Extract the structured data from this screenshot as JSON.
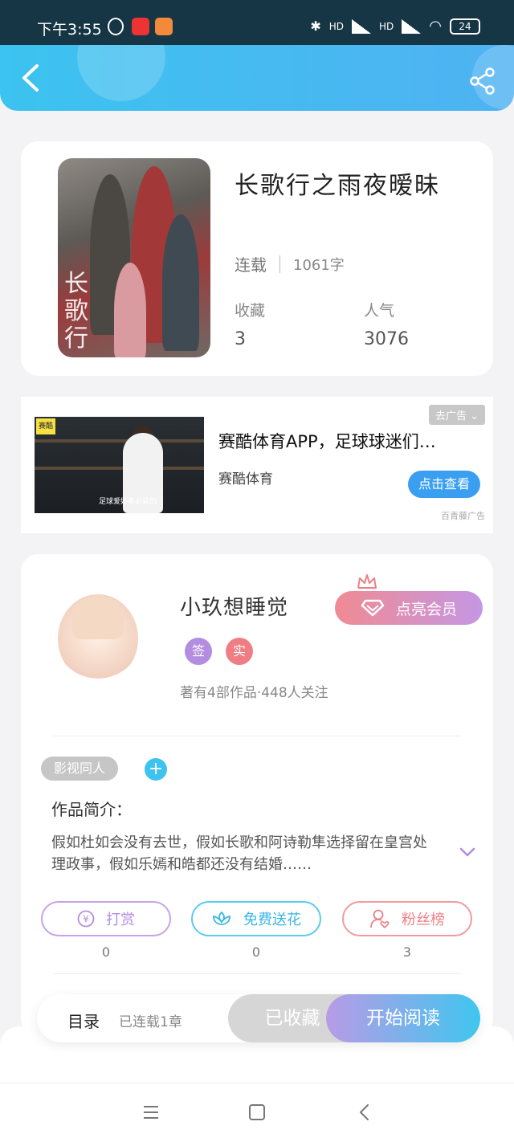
{
  "status_bar": {
    "time": "下午3:55",
    "battery": "24",
    "icons": [
      "alarm-icon",
      "netease-music-icon",
      "app-icon",
      "bluetooth-icon",
      "signal-icon",
      "signal-icon",
      "wifi-icon",
      "battery-icon"
    ],
    "hd_label": "HD"
  },
  "header": {
    "back_icon": "chevron-left-icon",
    "share_icon": "share-icon",
    "accent": "#3cc3f0"
  },
  "book": {
    "title": "长歌行之雨夜暧昧",
    "cover_text": "长歌行",
    "status": "连载",
    "word_count": "1061字",
    "favorites_label": "收藏",
    "favorites_value": "3",
    "popularity_label": "人气",
    "popularity_value": "3076"
  },
  "ad": {
    "close_label": "去广告",
    "title": "赛酷体育APP，足球球迷们…",
    "source": "赛酷体育",
    "button": "点击查看",
    "footer": "百青藤广告",
    "image_logo": "赛酷",
    "image_caption": "足球爱好者必装的"
  },
  "author": {
    "name": "小玖想睡觉",
    "badge_sign": "签",
    "badge_real": "实",
    "meta": "著有4部作品·448人关注",
    "vip_button": "点亮会员"
  },
  "work": {
    "genre_tag": "影视同人",
    "add_tag": "+",
    "intro_title": "作品简介：",
    "intro_text": "假如杜如会没有去世，假如长歌和阿诗勒隼选择留在皇宫处理政事，假如乐嫣和皓都还没有结婚……"
  },
  "actions": [
    {
      "label": "打赏",
      "count": "0",
      "icon": "yen-icon"
    },
    {
      "label": "免费送花",
      "count": "0",
      "icon": "flower-icon"
    },
    {
      "label": "粉丝榜",
      "count": "3",
      "icon": "user-heart-icon"
    }
  ],
  "read_bar": {
    "toc_label": "目录",
    "toc_sub": "已连载1章",
    "favorited_label": "已收藏",
    "read_label": "开始阅读"
  },
  "nav": {
    "menu_icon": "menu-icon",
    "home_icon": "home-square-icon",
    "back_icon": "back-triangle-icon"
  }
}
